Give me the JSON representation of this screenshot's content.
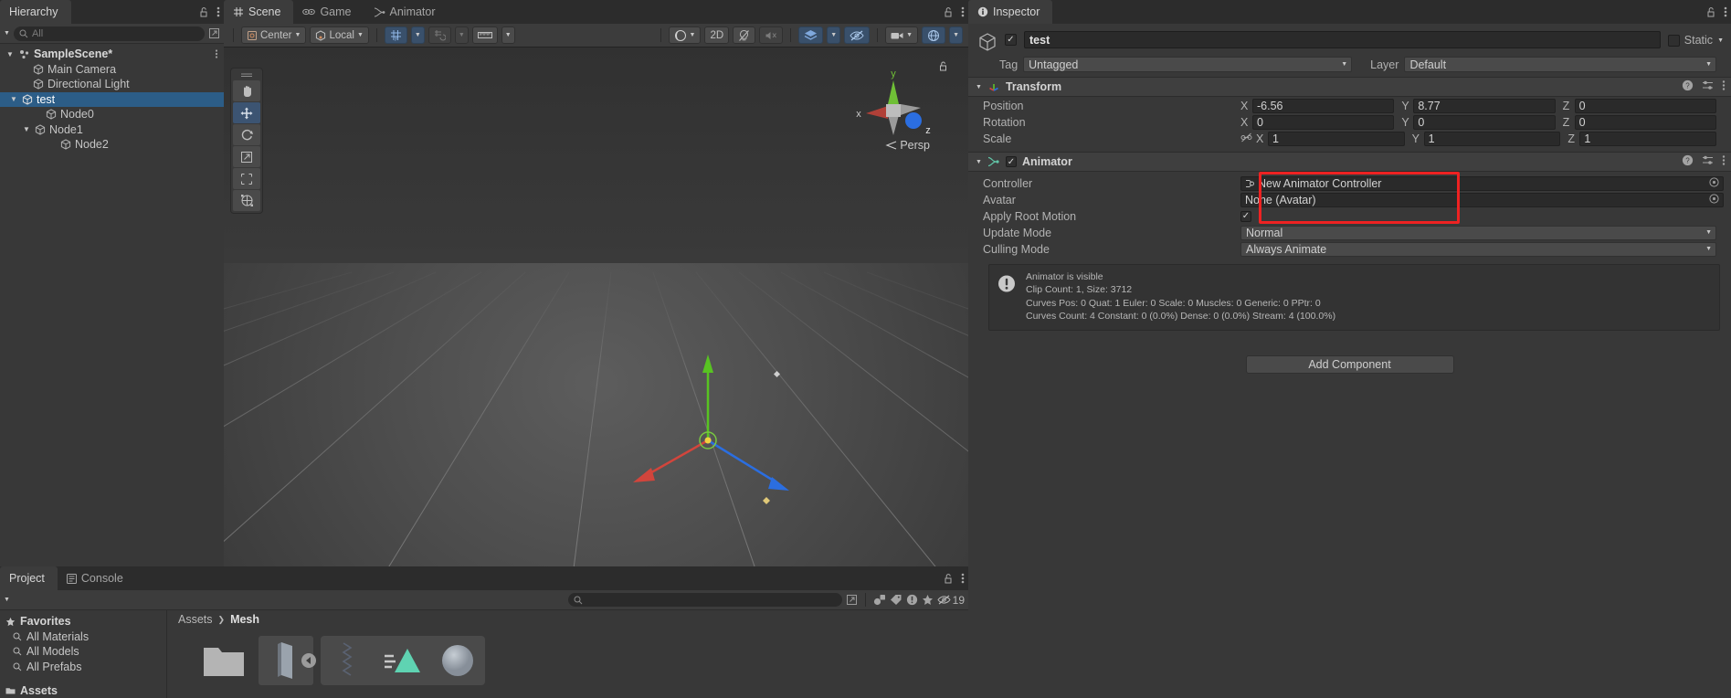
{
  "hierarchy": {
    "tab_label": "Hierarchy",
    "search_placeholder": "All",
    "lock_icon": "lock-open-icon",
    "menu_icon": "kebab-menu-icon",
    "items": [
      {
        "label": "SampleScene*",
        "depth": 0,
        "type": "scene",
        "expanded": true,
        "selected": false
      },
      {
        "label": "Main Camera",
        "depth": 1,
        "type": "gameobject",
        "expanded": null,
        "selected": false
      },
      {
        "label": "Directional Light",
        "depth": 1,
        "type": "gameobject",
        "expanded": null,
        "selected": false
      },
      {
        "label": "test",
        "depth": 1,
        "type": "gameobject",
        "expanded": true,
        "selected": true
      },
      {
        "label": "Node0",
        "depth": 2,
        "type": "gameobject",
        "expanded": null,
        "selected": false
      },
      {
        "label": "Node1",
        "depth": 2,
        "type": "gameobject",
        "expanded": true,
        "selected": false
      },
      {
        "label": "Node2",
        "depth": 3,
        "type": "gameobject",
        "expanded": null,
        "selected": false
      }
    ]
  },
  "scene": {
    "tabs": [
      {
        "label": "Scene",
        "icon": "grid-icon",
        "active": true
      },
      {
        "label": "Game",
        "icon": "gamepad-icon",
        "active": false
      },
      {
        "label": "Animator",
        "icon": "animator-icon",
        "active": false
      }
    ],
    "lock_icon": "lock-open-icon",
    "menu_icon": "kebab-menu-icon",
    "toolbar": {
      "pivot_mode": "Center",
      "space_mode": "Local",
      "grid_toggle": "grid-snap-icon",
      "grid_caret": "chevron-down-icon",
      "snap_increment": "snap-increment-icon",
      "snap_caret": "chevron-down-icon",
      "ruler": "ruler-icon",
      "ruler_caret": "chevron-down-icon",
      "shading_mode": "shaded-sphere-icon",
      "shading_caret": "chevron-down-icon",
      "view_2d": "2D",
      "lighting": "lighting-off-icon",
      "audio": "audio-off-icon",
      "fx": "effects-icon",
      "fx_caret": "chevron-down-icon",
      "scene_vis": "scene-visibility-off-icon",
      "camera": "camera-icon",
      "camera_caret": "chevron-down-icon",
      "gizmos": "gizmos-icon",
      "gizmos_caret": "chevron-down-icon"
    },
    "tools": [
      {
        "name": "hand-tool",
        "active": false
      },
      {
        "name": "move-tool",
        "active": true
      },
      {
        "name": "rotate-tool",
        "active": false
      },
      {
        "name": "scale-tool",
        "active": false
      },
      {
        "name": "rect-tool",
        "active": false
      },
      {
        "name": "transform-tool",
        "active": false
      }
    ],
    "gizmo": {
      "x_label": "x",
      "y_label": "y",
      "z_label": "z",
      "projection": "Persp"
    }
  },
  "inspector": {
    "tab_label": "Inspector",
    "tab_icon": "info-icon",
    "lock_icon": "lock-open-icon",
    "menu_icon": "kebab-menu-icon",
    "object": {
      "icon": "gameobject-cube-icon",
      "enabled": true,
      "name": "test",
      "static_label": "Static",
      "static_checked": false,
      "tag_label": "Tag",
      "tag_value": "Untagged",
      "layer_label": "Layer",
      "layer_value": "Default"
    },
    "transform": {
      "title": "Transform",
      "icon": "transform-axes-icon",
      "expanded": true,
      "help_icon": "help-icon",
      "preset_icon": "preset-icon",
      "menu_icon": "kebab-menu-icon",
      "rows": [
        {
          "label": "Position",
          "x": "-6.56",
          "y": "8.77",
          "z": "0",
          "has_link": false
        },
        {
          "label": "Rotation",
          "x": "0",
          "y": "0",
          "z": "0",
          "has_link": false
        },
        {
          "label": "Scale",
          "x": "1",
          "y": "1",
          "z": "1",
          "has_link": true,
          "link_icon": "constrain-proportions-off-icon"
        }
      ],
      "axis_labels": {
        "x": "X",
        "y": "Y",
        "z": "Z"
      }
    },
    "animator": {
      "title": "Animator",
      "icon": "animator-component-icon",
      "enabled": true,
      "expanded": true,
      "help_icon": "help-icon",
      "preset_icon": "preset-icon",
      "menu_icon": "kebab-menu-icon",
      "controller_label": "Controller",
      "controller_value": "New Animator Controller",
      "controller_value_icon": "animator-controller-asset-icon",
      "avatar_label": "Avatar",
      "avatar_value": "None (Avatar)",
      "apply_root_motion_label": "Apply Root Motion",
      "apply_root_motion_checked": true,
      "update_mode_label": "Update Mode",
      "update_mode_value": "Normal",
      "culling_mode_label": "Culling Mode",
      "culling_mode_value": "Always Animate",
      "object_picker_icon": "object-picker-icon",
      "helpbox": {
        "icon": "warning-icon",
        "lines": [
          "Animator is visible",
          "Clip Count: 1, Size: 3712",
          "Curves Pos: 0 Quat: 1 Euler: 0 Scale: 0 Muscles: 0 Generic: 0 PPtr: 0",
          "Curves Count: 4 Constant: 0 (0.0%) Dense: 0 (0.0%) Stream: 4 (100.0%)"
        ]
      }
    },
    "add_component_label": "Add Component",
    "annotation": {
      "color": "#ee2222",
      "shape": "rectangle"
    }
  },
  "project": {
    "tabs": [
      {
        "label": "Project",
        "icon": "",
        "active": true
      },
      {
        "label": "Console",
        "icon": "console-icon",
        "active": false
      }
    ],
    "lock_icon": "lock-open-icon",
    "menu_icon": "kebab-menu-icon",
    "search_placeholder": "",
    "search_icon": "search-icon",
    "filter_icons": [
      "asset-type-filter-icon",
      "label-filter-icon",
      "warning-filter-icon",
      "favorite-filter-icon"
    ],
    "hidden_count": "19",
    "hidden_icon": "eye-off-icon",
    "favorites": {
      "header": "Favorites",
      "header_icon": "star-icon",
      "items": [
        "All Materials",
        "All Models",
        "All Prefabs"
      ]
    },
    "assets": {
      "header": "Assets",
      "header_icon": "assets-folder-icon"
    },
    "breadcrumb": [
      "Assets",
      "Mesh"
    ],
    "grid_items": [
      {
        "label": "",
        "thumb": "folder-icon",
        "selected": false
      },
      {
        "label": "",
        "thumb": "plane-mesh-icon",
        "selected": false
      },
      {
        "label": "",
        "thumb": "animation-curve-icon",
        "selected": true
      },
      {
        "label": "",
        "thumb": "mesh-triangle-icon",
        "selected": true
      },
      {
        "label": "",
        "thumb": "sphere-material-icon",
        "selected": true
      }
    ]
  }
}
